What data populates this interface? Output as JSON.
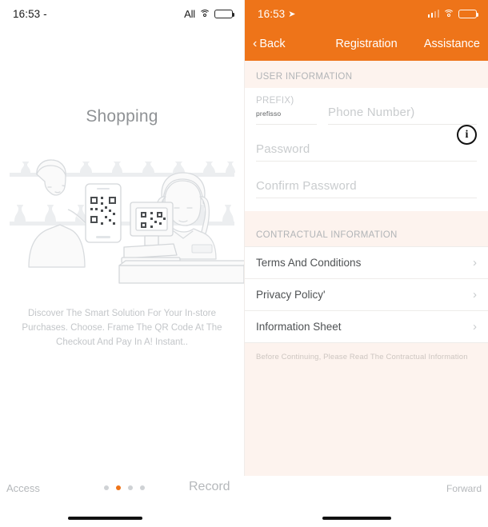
{
  "left": {
    "statusbar": {
      "time": "16:53 -",
      "carrier": "All",
      "wifi_icon": "wifi-icon",
      "battery_icon": "battery-icon"
    },
    "title": "Shopping",
    "illustration_name": "qr-checkout-illustration",
    "description": "Discover The Smart Solution For Your In-store Purchases. Choose. Frame The QR Code At The Checkout And Pay In A! Instant.."
  },
  "right": {
    "statusbar": {
      "time": "16:53",
      "location_icon": "location-arrow-icon",
      "signal_icon": "signal-bars-icon",
      "wifi_icon": "wifi-icon",
      "battery_icon": "battery-icon"
    },
    "navbar": {
      "back_label": "Back",
      "title": "Registration",
      "assistance_label": "Assistance",
      "accent_color": "#ee7419"
    },
    "user_section": {
      "header": "USER INFORMATION",
      "prefix_label": "PREFIX)",
      "prefix_value": "prefisso",
      "phone_placeholder": "Phone Number)",
      "password_placeholder": "Password",
      "confirm_password_placeholder": "Confirm Password",
      "info_icon_glyph": "i"
    },
    "contract_section": {
      "header": "CONTRACTUAL INFORMATION",
      "items": [
        {
          "label": "Terms And Conditions"
        },
        {
          "label": "Privacy Policy'"
        },
        {
          "label": "Information Sheet"
        }
      ],
      "note": "Before Continuing, Please Read The Contractual Information"
    }
  },
  "bottombar": {
    "left_label": "Access",
    "center_label": "Record",
    "right_label": "Forward",
    "dots_count": 4,
    "active_dot_index": 1,
    "active_dot_color": "#ee7419"
  }
}
